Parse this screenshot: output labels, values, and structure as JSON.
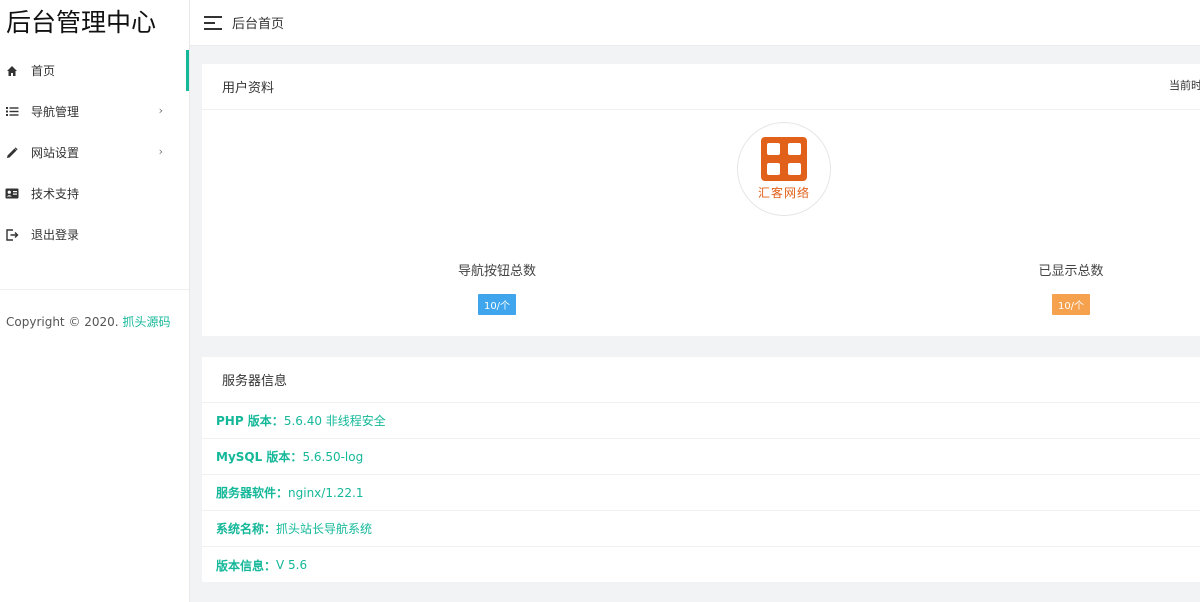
{
  "app": {
    "title": "后台管理中心"
  },
  "sidebar": {
    "items": [
      {
        "label": "首页",
        "icon": "home-icon",
        "active": true
      },
      {
        "label": "导航管理",
        "icon": "list-icon",
        "arrow": "›"
      },
      {
        "label": "网站设置",
        "icon": "pencil-icon",
        "arrow": "›"
      },
      {
        "label": "技术支持",
        "icon": "id-card-icon"
      },
      {
        "label": "退出登录",
        "icon": "logout-icon"
      }
    ],
    "copyright_prefix": "Copyright © 2020.",
    "copyright_link": "抓头源码"
  },
  "header": {
    "breadcrumb": "后台首页"
  },
  "profile": {
    "title": "用户资料",
    "current_time_label": "当前时",
    "logo_text": "汇客网络",
    "stats": [
      {
        "label": "导航按钮总数",
        "value": "10/个",
        "color": "#3fa6ee"
      },
      {
        "label": "已显示总数",
        "value": "10/个",
        "color": "#f5a14d"
      }
    ]
  },
  "server": {
    "title": "服务器信息",
    "rows": [
      {
        "key": "PHP 版本：",
        "value": "5.6.40 非线程安全"
      },
      {
        "key": "MySQL 版本：",
        "value": "5.6.50-log"
      },
      {
        "key": "服务器软件：",
        "value": "nginx/1.22.1"
      },
      {
        "key": "系统名称：",
        "value": "抓头站长导航系统"
      },
      {
        "key": "版本信息：",
        "value": "V 5.6"
      }
    ]
  },
  "colors": {
    "accent": "#16b89a",
    "logo": "#e2611a"
  }
}
